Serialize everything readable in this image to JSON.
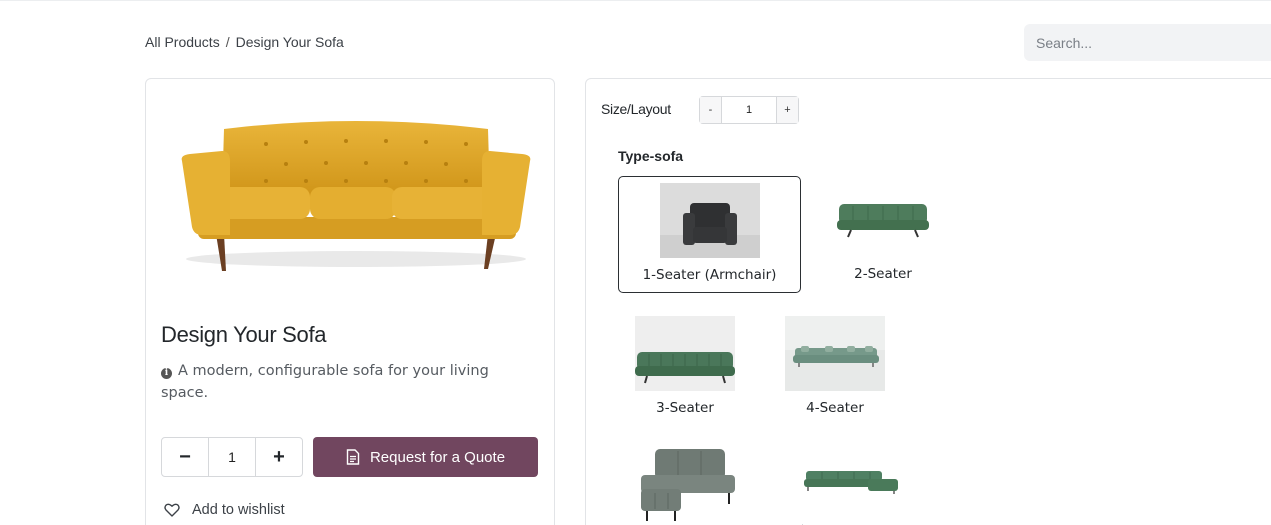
{
  "breadcrumb": {
    "parent": "All Products",
    "separator": "/",
    "current": "Design Your Sofa"
  },
  "search": {
    "placeholder": "Search..."
  },
  "product": {
    "title": "Design Your Sofa",
    "description": "A modern, configurable sofa for your living space.",
    "quantity": "1",
    "quote_label": "Request for a Quote",
    "wishlist_label": "Add to wishlist",
    "minus": "−",
    "plus": "+"
  },
  "configurator": {
    "size_label": "Size/Layout",
    "size_value": "1",
    "minus": "-",
    "plus": "+",
    "type_label": "Type-sofa",
    "options": [
      {
        "label": "1-Seater (Armchair)",
        "selected": true
      },
      {
        "label": "2-Seater",
        "selected": false
      },
      {
        "label": "3-Seater",
        "selected": false
      },
      {
        "label": "4-Seater",
        "selected": false
      },
      {
        "label": "",
        "selected": false
      },
      {
        "label": "",
        "selected": false
      }
    ]
  },
  "colors": {
    "accent": "#71465f",
    "sofa_yellow": "#e5ad2c",
    "sofa_green": "#4a7a5a"
  }
}
